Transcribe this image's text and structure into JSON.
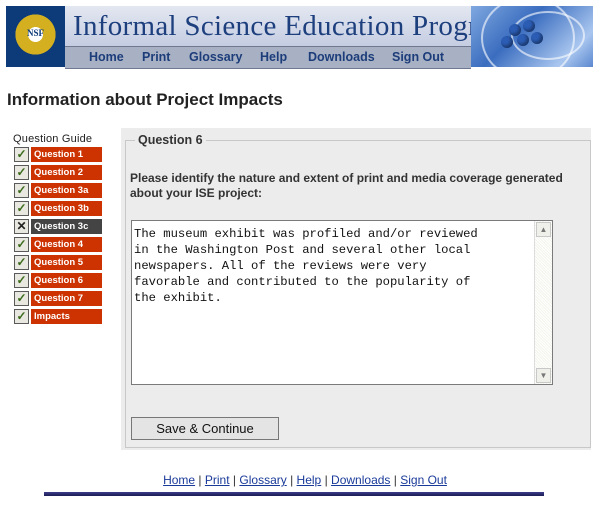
{
  "header": {
    "logo_text": "NSF",
    "title": "Informal Science Education Program",
    "nav": [
      "Home",
      "Print",
      "Glossary",
      "Help",
      "Downloads",
      "Sign Out"
    ]
  },
  "page": {
    "heading": "Information about Project Impacts"
  },
  "guide": {
    "title": "Question Guide",
    "items": [
      {
        "label": "Question 1",
        "state": "checked"
      },
      {
        "label": "Question 2",
        "state": "checked"
      },
      {
        "label": "Question 3a",
        "state": "checked"
      },
      {
        "label": "Question 3b",
        "state": "checked"
      },
      {
        "label": "Question 3c",
        "state": "x"
      },
      {
        "label": "Question 4",
        "state": "checked"
      },
      {
        "label": "Question 5",
        "state": "checked"
      },
      {
        "label": "Question 6",
        "state": "checked"
      },
      {
        "label": "Question 7",
        "state": "checked"
      },
      {
        "label": "Impacts",
        "state": "checked"
      }
    ]
  },
  "question": {
    "legend": "Question 6",
    "prompt": "Please identify the nature and extent of print and media coverage generated about your ISE project:",
    "answer": "The museum exhibit was profiled and/or reviewed\nin the Washington Post and several other local\nnewspapers. All of the reviews were very\nfavorable and contributed to the popularity of\nthe exhibit.",
    "save_label": "Save & Continue"
  },
  "footer": {
    "links": [
      "Home",
      "Print",
      "Glossary",
      "Help",
      "Downloads",
      "Sign Out"
    ],
    "separator": "|"
  },
  "icons": {
    "check": "checkmark-icon",
    "x": "x-mark-icon",
    "scroll_up": "scroll-up-arrow-icon",
    "scroll_down": "scroll-down-arrow-icon"
  },
  "colors": {
    "guide_label": "#cc3300",
    "guide_current": "#444444",
    "title": "#1d3f7e",
    "link": "#1a3a99"
  }
}
